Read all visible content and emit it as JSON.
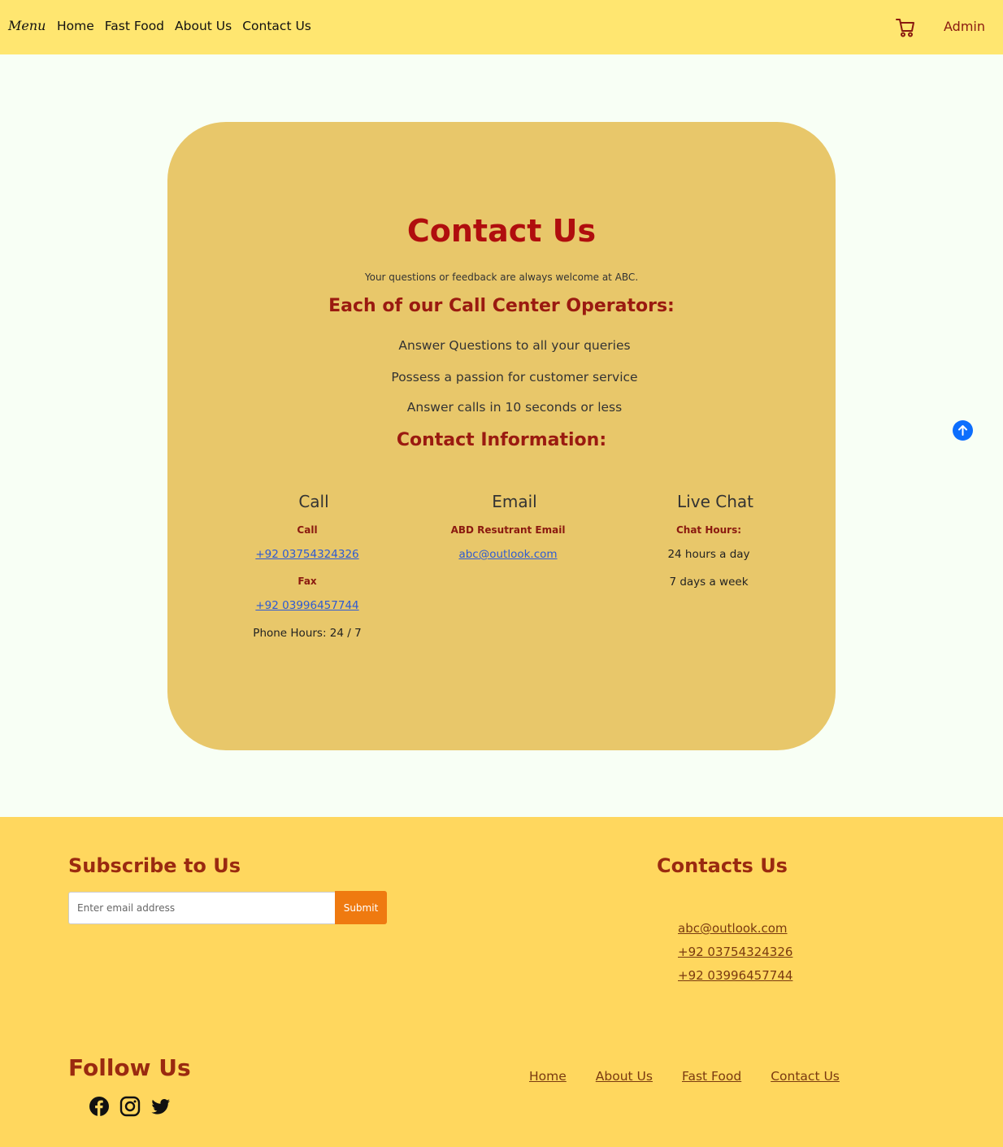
{
  "navbar": {
    "brand": "Menu",
    "links": [
      "Home",
      "Fast Food",
      "About Us",
      "Contact Us"
    ],
    "admin": "Admin",
    "cart_icon": "cart-icon"
  },
  "contact": {
    "title": "Contact Us",
    "subtitle": "Your questions or feedback are always welcome at ABC.",
    "operators_heading": "Each of our Call Center Operators:",
    "operator_items": [
      "Answer Questions to all your queries",
      "Possess a passion for customer service",
      "Answer calls in 10 seconds or less"
    ],
    "info_heading": "Contact Information:",
    "columns": {
      "call": {
        "title": "Call",
        "call_label": "Call",
        "call_number": "+92 03754324326",
        "fax_label": "Fax",
        "fax_number": "+92 03996457744",
        "hours": "Phone Hours: 24 / 7"
      },
      "email": {
        "title": "Email",
        "label": "ABD Resutrant Email",
        "address": "abc@outlook.com"
      },
      "chat": {
        "title": "Live Chat",
        "label": "Chat Hours:",
        "line1": "24 hours a day",
        "line2": "7 days a week"
      }
    }
  },
  "scroll_top_icon": "arrow-up-icon",
  "footer": {
    "subscribe_heading": "Subscribe to Us",
    "email_placeholder": "Enter email address",
    "submit_label": "Submit",
    "contacts_heading": "Contacts Us",
    "contacts": [
      "abc@outlook.com",
      "+92 03754324326",
      "+92 03996457744"
    ],
    "follow_heading": "Follow Us",
    "social_icons": [
      "facebook-icon",
      "instagram-icon",
      "twitter-icon"
    ],
    "nav_links": [
      "Home",
      "About Us",
      "Fast Food",
      "Contact Us"
    ]
  },
  "colors": {
    "navbar_bg": "#ffe670",
    "page_bg": "#f8fff5",
    "card_bg": "#e8c76a",
    "title_red": "#b00e0e",
    "heading_red": "#9a1a10",
    "footer_bg": "#ffd75e",
    "submit_orange": "#ef7a10",
    "scroll_blue": "#0d6efd"
  }
}
